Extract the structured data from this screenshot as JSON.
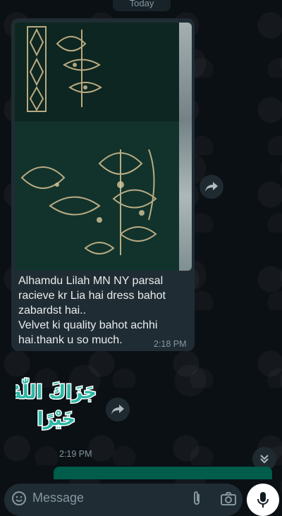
{
  "chat": {
    "date_label": "Today",
    "message": {
      "lines": [
        "Alhamdu Lilah  MN NY parsal",
        "racieve kr Lia hai dress bahot",
        "zabardst hai..",
        "Velvet ki quality bahot achhi",
        "hai.thank u so much."
      ],
      "time": "2:18 PM"
    },
    "sticker": {
      "text_line1": "جَزَاكَ اللّٰهُ",
      "text_line2": "خَيْرًا"
    },
    "next_time": "2:19 PM"
  },
  "composer": {
    "placeholder": "Message"
  },
  "icons": {
    "forward": "forward-icon",
    "emoji": "emoji-icon",
    "attach": "paperclip-icon",
    "camera": "camera-icon",
    "mic": "mic-icon",
    "scroll_down": "chevron-double-down-icon"
  },
  "colors": {
    "background": "#0b1014",
    "bubble_incoming": "#202c33",
    "bubble_outgoing": "#005c4b",
    "sticker_teal": "#2bb8a6"
  }
}
